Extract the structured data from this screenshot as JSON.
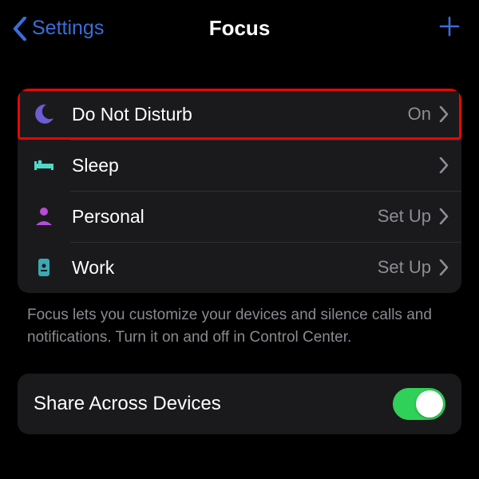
{
  "header": {
    "back_label": "Settings",
    "title": "Focus"
  },
  "focus_items": [
    {
      "label": "Do Not Disturb",
      "status": "On",
      "highlight": true
    },
    {
      "label": "Sleep",
      "status": "",
      "highlight": false
    },
    {
      "label": "Personal",
      "status": "Set Up",
      "highlight": false
    },
    {
      "label": "Work",
      "status": "Set Up",
      "highlight": false
    }
  ],
  "footer_text": "Focus lets you customize your devices and silence calls and notifications. Turn it on and off in Control Center.",
  "share_row": {
    "label": "Share Across Devices",
    "enabled": true
  },
  "colors": {
    "accent_blue": "#3a6dd8",
    "moon_purple": "#6b5dd3",
    "sleep_teal": "#4fd9c9",
    "personal_purple": "#b84cd8",
    "work_teal": "#3aa8b5",
    "toggle_green": "#30d158",
    "highlight_red": "#e80605"
  }
}
